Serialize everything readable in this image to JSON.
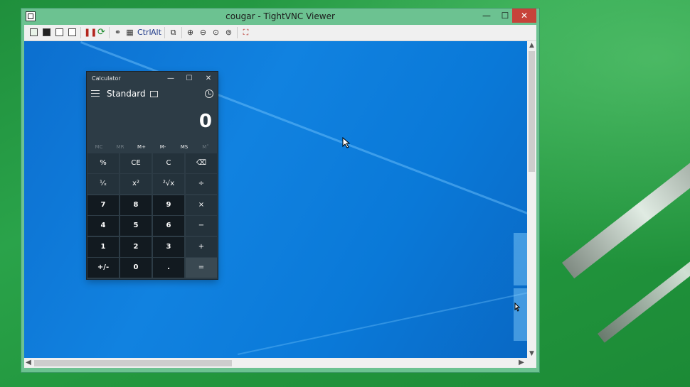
{
  "window": {
    "title": "cougar - TightVNC Viewer",
    "minimize": "—",
    "maximize": "☐",
    "close": "✕"
  },
  "toolbar": {
    "ctrl_label": "Ctrl",
    "alt_label": "Alt"
  },
  "scrollbars": {
    "up": "▲",
    "down": "▼",
    "left": "◀",
    "right": "▶"
  },
  "calculator": {
    "title": "Calculator",
    "mode": "Standard",
    "display": "0",
    "title_controls": {
      "minimize": "—",
      "maximize": "☐",
      "close": "✕"
    },
    "memory": [
      {
        "label": "MC",
        "enabled": false
      },
      {
        "label": "MR",
        "enabled": false
      },
      {
        "label": "M+",
        "enabled": true
      },
      {
        "label": "M-",
        "enabled": true
      },
      {
        "label": "MS",
        "enabled": true
      },
      {
        "label": "M˅",
        "enabled": false
      }
    ],
    "keys": [
      [
        "%",
        "CE",
        "C",
        "⌫"
      ],
      [
        "¹⁄ₓ",
        "x²",
        "²√x",
        "÷"
      ],
      [
        "7",
        "8",
        "9",
        "×"
      ],
      [
        "4",
        "5",
        "6",
        "−"
      ],
      [
        "1",
        "2",
        "3",
        "+"
      ],
      [
        "+/-",
        "0",
        ".",
        "="
      ]
    ]
  },
  "colors": {
    "calc_bg": "#2d3c46",
    "desktop_blue": "#1182e0",
    "close_red": "#c7423a"
  }
}
